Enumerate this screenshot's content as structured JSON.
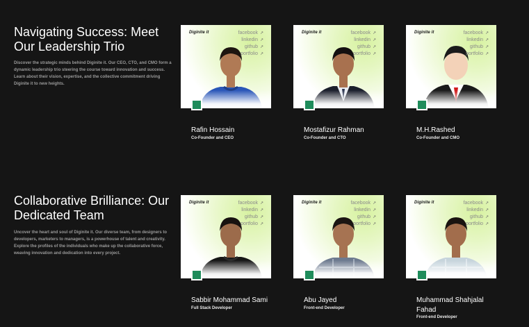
{
  "leadership": {
    "title": "Navigating Success: Meet Our Leadership Trio",
    "description": "Discover the strategic minds behind Diginite it. Our CEO, CTO, and CMO form a dynamic leadership trio steering the course toward innovation and success. Learn about their vision, expertise, and the collective commitment driving Diginite it to new heights.",
    "members": [
      {
        "name": "Rafin Hossain",
        "role": "Co-Founder and CEO"
      },
      {
        "name": "Mostafizur Rahman",
        "role": "Co-Founder and CTO"
      },
      {
        "name": "M.H.Rashed",
        "role": "Co-Founder and CMO"
      }
    ]
  },
  "team": {
    "title": "Collaborative Brilliance: Our Dedicated Team",
    "description": "Uncover the heart and soul of Diginite it. Our diverse team, from designers to developers, marketers to managers, is a powerhouse of talent and creativity. Explore the profiles of the individuals who make up the collaborative force, weaving innovation and dedication into every project.",
    "members": [
      {
        "name": "Sabbir Mohammad Sami",
        "role": "Full Stack Developer"
      },
      {
        "name": "Abu Jayed",
        "role": "Front-end Developer"
      },
      {
        "name": "Muhammad Shahjalal Fahad",
        "role": "Front-end Developer"
      }
    ]
  },
  "card": {
    "logo": "Diginite it",
    "socials": [
      "facebook",
      "linkedin",
      "github",
      "portfolio"
    ],
    "arrow": "↗"
  },
  "colors": {
    "background": "#151515",
    "badge": "#1f8c5b",
    "card_tint": "#d7f2a0"
  }
}
